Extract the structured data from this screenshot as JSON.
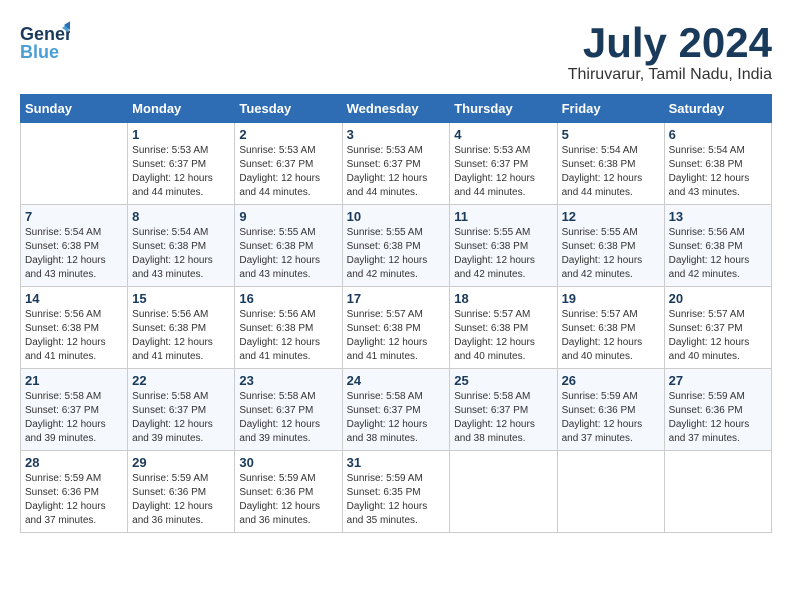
{
  "header": {
    "logo_line1": "General",
    "logo_line2": "Blue",
    "month_title": "July 2024",
    "location": "Thiruvarur, Tamil Nadu, India"
  },
  "days_of_week": [
    "Sunday",
    "Monday",
    "Tuesday",
    "Wednesday",
    "Thursday",
    "Friday",
    "Saturday"
  ],
  "weeks": [
    [
      {
        "day": "",
        "info": ""
      },
      {
        "day": "1",
        "info": "Sunrise: 5:53 AM\nSunset: 6:37 PM\nDaylight: 12 hours\nand 44 minutes."
      },
      {
        "day": "2",
        "info": "Sunrise: 5:53 AM\nSunset: 6:37 PM\nDaylight: 12 hours\nand 44 minutes."
      },
      {
        "day": "3",
        "info": "Sunrise: 5:53 AM\nSunset: 6:37 PM\nDaylight: 12 hours\nand 44 minutes."
      },
      {
        "day": "4",
        "info": "Sunrise: 5:53 AM\nSunset: 6:37 PM\nDaylight: 12 hours\nand 44 minutes."
      },
      {
        "day": "5",
        "info": "Sunrise: 5:54 AM\nSunset: 6:38 PM\nDaylight: 12 hours\nand 44 minutes."
      },
      {
        "day": "6",
        "info": "Sunrise: 5:54 AM\nSunset: 6:38 PM\nDaylight: 12 hours\nand 43 minutes."
      }
    ],
    [
      {
        "day": "7",
        "info": "Sunrise: 5:54 AM\nSunset: 6:38 PM\nDaylight: 12 hours\nand 43 minutes."
      },
      {
        "day": "8",
        "info": "Sunrise: 5:54 AM\nSunset: 6:38 PM\nDaylight: 12 hours\nand 43 minutes."
      },
      {
        "day": "9",
        "info": "Sunrise: 5:55 AM\nSunset: 6:38 PM\nDaylight: 12 hours\nand 43 minutes."
      },
      {
        "day": "10",
        "info": "Sunrise: 5:55 AM\nSunset: 6:38 PM\nDaylight: 12 hours\nand 42 minutes."
      },
      {
        "day": "11",
        "info": "Sunrise: 5:55 AM\nSunset: 6:38 PM\nDaylight: 12 hours\nand 42 minutes."
      },
      {
        "day": "12",
        "info": "Sunrise: 5:55 AM\nSunset: 6:38 PM\nDaylight: 12 hours\nand 42 minutes."
      },
      {
        "day": "13",
        "info": "Sunrise: 5:56 AM\nSunset: 6:38 PM\nDaylight: 12 hours\nand 42 minutes."
      }
    ],
    [
      {
        "day": "14",
        "info": "Sunrise: 5:56 AM\nSunset: 6:38 PM\nDaylight: 12 hours\nand 41 minutes."
      },
      {
        "day": "15",
        "info": "Sunrise: 5:56 AM\nSunset: 6:38 PM\nDaylight: 12 hours\nand 41 minutes."
      },
      {
        "day": "16",
        "info": "Sunrise: 5:56 AM\nSunset: 6:38 PM\nDaylight: 12 hours\nand 41 minutes."
      },
      {
        "day": "17",
        "info": "Sunrise: 5:57 AM\nSunset: 6:38 PM\nDaylight: 12 hours\nand 41 minutes."
      },
      {
        "day": "18",
        "info": "Sunrise: 5:57 AM\nSunset: 6:38 PM\nDaylight: 12 hours\nand 40 minutes."
      },
      {
        "day": "19",
        "info": "Sunrise: 5:57 AM\nSunset: 6:38 PM\nDaylight: 12 hours\nand 40 minutes."
      },
      {
        "day": "20",
        "info": "Sunrise: 5:57 AM\nSunset: 6:37 PM\nDaylight: 12 hours\nand 40 minutes."
      }
    ],
    [
      {
        "day": "21",
        "info": "Sunrise: 5:58 AM\nSunset: 6:37 PM\nDaylight: 12 hours\nand 39 minutes."
      },
      {
        "day": "22",
        "info": "Sunrise: 5:58 AM\nSunset: 6:37 PM\nDaylight: 12 hours\nand 39 minutes."
      },
      {
        "day": "23",
        "info": "Sunrise: 5:58 AM\nSunset: 6:37 PM\nDaylight: 12 hours\nand 39 minutes."
      },
      {
        "day": "24",
        "info": "Sunrise: 5:58 AM\nSunset: 6:37 PM\nDaylight: 12 hours\nand 38 minutes."
      },
      {
        "day": "25",
        "info": "Sunrise: 5:58 AM\nSunset: 6:37 PM\nDaylight: 12 hours\nand 38 minutes."
      },
      {
        "day": "26",
        "info": "Sunrise: 5:59 AM\nSunset: 6:36 PM\nDaylight: 12 hours\nand 37 minutes."
      },
      {
        "day": "27",
        "info": "Sunrise: 5:59 AM\nSunset: 6:36 PM\nDaylight: 12 hours\nand 37 minutes."
      }
    ],
    [
      {
        "day": "28",
        "info": "Sunrise: 5:59 AM\nSunset: 6:36 PM\nDaylight: 12 hours\nand 37 minutes."
      },
      {
        "day": "29",
        "info": "Sunrise: 5:59 AM\nSunset: 6:36 PM\nDaylight: 12 hours\nand 36 minutes."
      },
      {
        "day": "30",
        "info": "Sunrise: 5:59 AM\nSunset: 6:36 PM\nDaylight: 12 hours\nand 36 minutes."
      },
      {
        "day": "31",
        "info": "Sunrise: 5:59 AM\nSunset: 6:35 PM\nDaylight: 12 hours\nand 35 minutes."
      },
      {
        "day": "",
        "info": ""
      },
      {
        "day": "",
        "info": ""
      },
      {
        "day": "",
        "info": ""
      }
    ]
  ]
}
